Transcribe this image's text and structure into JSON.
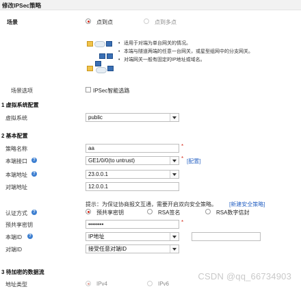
{
  "title": "修改IPSec策略",
  "scene": {
    "label": "场景",
    "options": [
      "点到点",
      "点到多点"
    ],
    "selected": 0,
    "info": [
      "适用于对端为单台网关的情况。",
      "本端与隧道两端的任意一台网关，或星型组网中的分支网关。",
      "对端网关一般有固定的IP地址或域名。"
    ]
  },
  "scene_options": {
    "label": "场景选项",
    "checkbox_label": "IPSec智能选路",
    "checked": false
  },
  "sec1": {
    "title": "1 虚拟系统配置",
    "vsys_label": "虚拟系统",
    "vsys_value": "public"
  },
  "sec2": {
    "title": "2 基本配置",
    "policy_name_label": "策略名称",
    "policy_name_value": "aa",
    "local_iface_label": "本端接口",
    "local_iface_value": "GE1/0/0(to untrust)",
    "config_link": "[配置]",
    "local_addr_label": "本端地址",
    "local_addr_value": "23.0.0.1",
    "peer_addr_label": "对端地址",
    "peer_addr_value": "12.0.0.1",
    "hint_text": "提示：为保证协商报文互通，需要开启双向安全策略。",
    "hint_link": "[新建安全策略]",
    "auth_label": "认证方式",
    "auth_options": [
      "预共享密钥",
      "RSA签名",
      "RSA数字信封"
    ],
    "auth_selected": 0,
    "psk_label": "预共享密钥",
    "psk_value": "••••••••",
    "local_id_label": "本端ID",
    "local_id_value": "IP地址",
    "peer_id_label": "对端ID",
    "peer_id_value": "接受任意对端ID"
  },
  "sec3": {
    "title": "3 待加密的数据流",
    "addr_type_label": "地址类型",
    "addr_type_options": [
      "IPv4",
      "IPv6"
    ],
    "addr_type_selected": 0
  },
  "watermark": "CSDN @qq_66734903",
  "colors": {
    "required": "#d4291a",
    "link": "#2a64c4",
    "help_icon": "#3d7fd1"
  }
}
